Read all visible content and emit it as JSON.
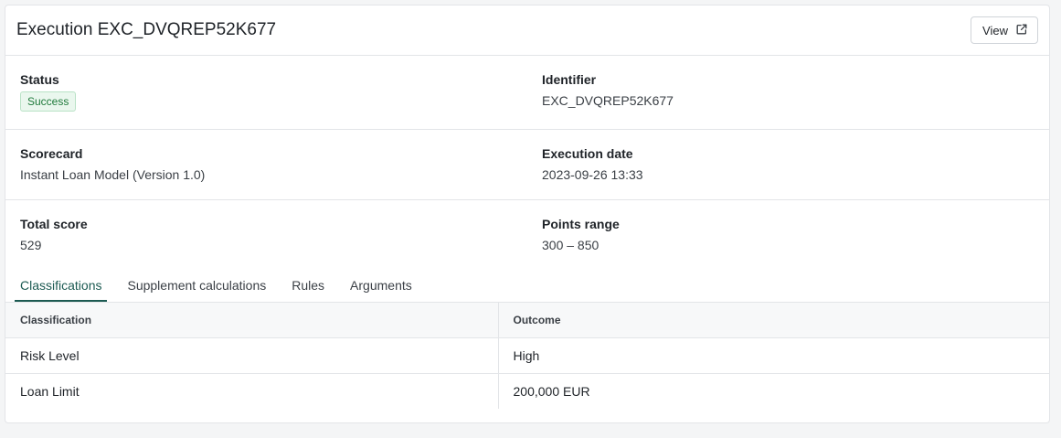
{
  "header": {
    "title": "Execution EXC_DVQREP52K677",
    "view_label": "View"
  },
  "details": {
    "status_label": "Status",
    "status_value": "Success",
    "identifier_label": "Identifier",
    "identifier_value": "EXC_DVQREP52K677",
    "scorecard_label": "Scorecard",
    "scorecard_value": "Instant Loan Model (Version 1.0)",
    "execution_date_label": "Execution date",
    "execution_date_value": "2023-09-26 13:33",
    "total_score_label": "Total score",
    "total_score_value": "529",
    "points_range_label": "Points range",
    "points_range_value": "300 – 850"
  },
  "tabs": [
    {
      "label": "Classifications",
      "active": true
    },
    {
      "label": "Supplement calculations",
      "active": false
    },
    {
      "label": "Rules",
      "active": false
    },
    {
      "label": "Arguments",
      "active": false
    }
  ],
  "table": {
    "columns": [
      "Classification",
      "Outcome"
    ],
    "rows": [
      [
        "Risk Level",
        "High"
      ],
      [
        "Loan Limit",
        "200,000 EUR"
      ]
    ]
  },
  "colors": {
    "accent": "#1c5a52",
    "success_text": "#1f7a3b",
    "success_bg": "#eaf7ee"
  },
  "icons": {
    "view": "external-link-icon"
  }
}
